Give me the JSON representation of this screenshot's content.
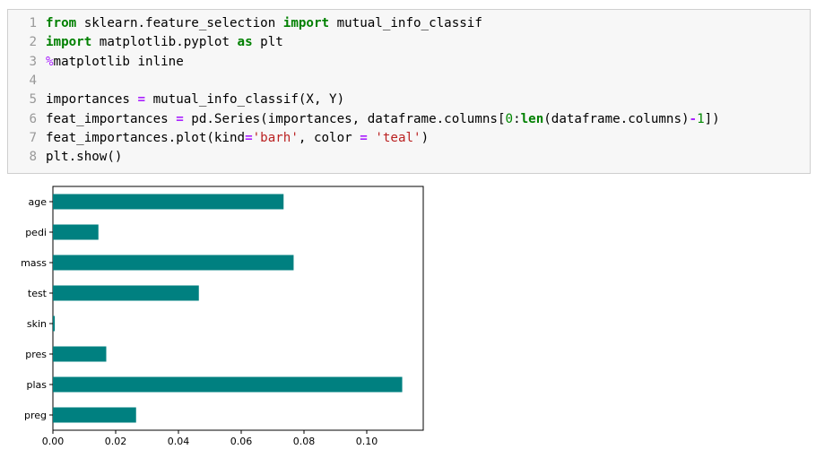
{
  "code": {
    "lines": [
      {
        "n": "1",
        "tokens": [
          {
            "t": "from",
            "c": "kw"
          },
          {
            "t": " sklearn.feature_selection ",
            "c": "nm"
          },
          {
            "t": "import",
            "c": "kw"
          },
          {
            "t": " mutual_info_classif",
            "c": "nm"
          }
        ]
      },
      {
        "n": "2",
        "tokens": [
          {
            "t": "import",
            "c": "kw"
          },
          {
            "t": " matplotlib.pyplot ",
            "c": "nm"
          },
          {
            "t": "as",
            "c": "kw"
          },
          {
            "t": " plt",
            "c": "nm"
          }
        ]
      },
      {
        "n": "3",
        "tokens": [
          {
            "t": "%",
            "c": "magic"
          },
          {
            "t": "matplotlib inline",
            "c": "nm"
          }
        ]
      },
      {
        "n": "4",
        "tokens": []
      },
      {
        "n": "5",
        "tokens": [
          {
            "t": "importances ",
            "c": "nm"
          },
          {
            "t": "=",
            "c": "op"
          },
          {
            "t": " mutual_info_classif(X, Y)",
            "c": "nm"
          }
        ]
      },
      {
        "n": "6",
        "tokens": [
          {
            "t": "feat_importances ",
            "c": "nm"
          },
          {
            "t": "=",
            "c": "op"
          },
          {
            "t": " pd.Series(importances, dataframe.columns[",
            "c": "nm"
          },
          {
            "t": "0",
            "c": "num"
          },
          {
            "t": ":",
            "c": "nm"
          },
          {
            "t": "len",
            "c": "kw"
          },
          {
            "t": "(dataframe.columns)",
            "c": "nm"
          },
          {
            "t": "-",
            "c": "op"
          },
          {
            "t": "1",
            "c": "num"
          },
          {
            "t": "])",
            "c": "nm"
          }
        ]
      },
      {
        "n": "7",
        "tokens": [
          {
            "t": "feat_importances.plot(kind",
            "c": "nm"
          },
          {
            "t": "=",
            "c": "op"
          },
          {
            "t": "'barh'",
            "c": "str"
          },
          {
            "t": ", color ",
            "c": "nm"
          },
          {
            "t": "=",
            "c": "op"
          },
          {
            "t": " ",
            "c": "nm"
          },
          {
            "t": "'teal'",
            "c": "str"
          },
          {
            "t": ")",
            "c": "nm"
          }
        ]
      },
      {
        "n": "8",
        "tokens": [
          {
            "t": "plt.show()",
            "c": "nm"
          }
        ]
      }
    ]
  },
  "chart_data": {
    "type": "bar",
    "orientation": "horizontal",
    "categories": [
      "age",
      "pedi",
      "mass",
      "test",
      "skin",
      "pres",
      "plas",
      "preg"
    ],
    "values": [
      0.0735,
      0.0145,
      0.0767,
      0.0465,
      0.0006,
      0.017,
      0.1113,
      0.0265
    ],
    "xlim": [
      0.0,
      0.118
    ],
    "xticks": [
      "0.00",
      "0.02",
      "0.04",
      "0.06",
      "0.08",
      "0.10"
    ],
    "color": "#008080",
    "title": "",
    "xlabel": "",
    "ylabel": ""
  }
}
